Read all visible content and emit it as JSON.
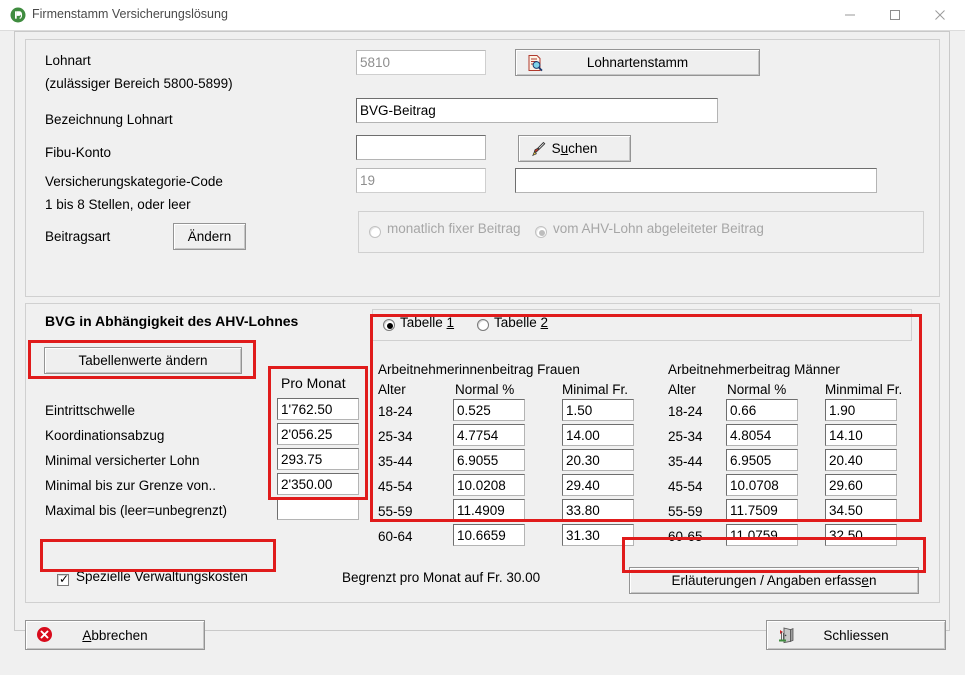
{
  "window": {
    "title": "Firmenstamm Versicherungslösung",
    "app_icon": "app-icon",
    "minimize": "–",
    "maximize": "□",
    "close": "✕"
  },
  "form": {
    "lohnart_label": "Lohnart",
    "lohnart_hint": "(zulässiger Bereich 5800-5899)",
    "lohnart_value": "5810",
    "lohnartenstamm_button": "Lohnartenstamm",
    "bezeichnung_label": "Bezeichnung Lohnart",
    "bezeichnung_value": "BVG-Beitrag",
    "fibu_label": "Fibu-Konto",
    "fibu_value": "",
    "suchen_button": "Suchen",
    "vkat_label": "Versicherungskategorie-Code",
    "vkat_hint": "1 bis 8 Stellen, oder leer",
    "vkat_value": "19",
    "vkat_text_value": "",
    "beitragsart_label": "Beitragsart",
    "aendern_button": "Ändern",
    "beitragsart_options": [
      {
        "label": "monatlich fixer Beitrag",
        "selected": false
      },
      {
        "label": "vom AHV-Lohn abgeleiteter Beitrag",
        "selected": true
      }
    ]
  },
  "bvg": {
    "group_title": "BVG in Abhängigkeit des AHV-Lohnes",
    "tabellenwerte_button": "Tabellenwerte ändern",
    "tabelle_options": [
      {
        "label": "Tabelle 1",
        "accel": "1",
        "selected": true
      },
      {
        "label": "Tabelle 2",
        "accel": "2",
        "selected": false
      }
    ],
    "pro_monat_header": "Pro Monat",
    "rows": [
      {
        "label": "Eintrittschwelle",
        "value": "1'762.50"
      },
      {
        "label": "Koordinationsabzug",
        "value": "2'056.25"
      },
      {
        "label": "Minimal versicherter Lohn",
        "value": "293.75"
      },
      {
        "label": "Minimal bis zur Grenze von..",
        "value": "2'350.00"
      },
      {
        "label": "Maximal bis (leer=unbegrenzt)",
        "value": ""
      }
    ],
    "tables": [
      {
        "title": "Arbeitnehmerinnenbeitrag Frauen",
        "headers": [
          "Alter",
          "Normal %",
          "Minimal Fr."
        ],
        "rows": [
          {
            "alter": "18-24",
            "normal": "0.525",
            "minimal": "1.50"
          },
          {
            "alter": "25-34",
            "normal": "4.7754",
            "minimal": "14.00"
          },
          {
            "alter": "35-44",
            "normal": "6.9055",
            "minimal": "20.30"
          },
          {
            "alter": "45-54",
            "normal": "10.0208",
            "minimal": "29.40"
          },
          {
            "alter": "55-59",
            "normal": "11.4909",
            "minimal": "33.80"
          },
          {
            "alter": "60-64",
            "normal": "10.6659",
            "minimal": "31.30"
          }
        ]
      },
      {
        "title": "Arbeitnehmerbeitrag Männer",
        "headers": [
          "Alter",
          "Normal %",
          "Minmimal Fr."
        ],
        "rows": [
          {
            "alter": "18-24",
            "normal": "0.66",
            "minimal": "1.90"
          },
          {
            "alter": "25-34",
            "normal": "4.8054",
            "minimal": "14.10"
          },
          {
            "alter": "35-44",
            "normal": "6.9505",
            "minimal": "20.40"
          },
          {
            "alter": "45-54",
            "normal": "10.0708",
            "minimal": "29.60"
          },
          {
            "alter": "55-59",
            "normal": "11.7509",
            "minimal": "34.50"
          },
          {
            "alter": "60-65",
            "normal": "11.0759",
            "minimal": "32.50"
          }
        ]
      }
    ],
    "verwaltungskosten_label": "Spezielle Verwaltungskosten",
    "verwaltungskosten_checked": true,
    "begrenzt_text": "Begrenzt pro Monat auf Fr. 30.00",
    "erlaeuterungen_button_pre": "Erläuterungen / Angaben erfass",
    "erlaeuterungen_button_accel": "e",
    "erlaeuterungen_button_post": "n"
  },
  "footer": {
    "abbrechen_accel": "A",
    "abbrechen_rest": "bbrechen",
    "schliessen_button": "Schliessen"
  },
  "colors": {
    "annotation": "#e01b1b",
    "window_bg": "#f0f0f0",
    "accent_green": "#3f8c3f"
  }
}
